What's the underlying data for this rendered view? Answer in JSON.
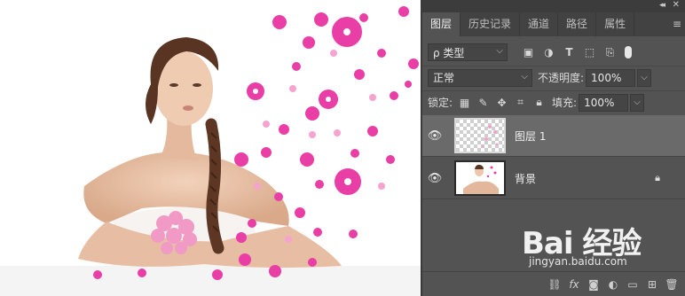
{
  "panel": {
    "tabs": [
      {
        "label": "图层",
        "active": true
      },
      {
        "label": "历史记录"
      },
      {
        "label": "通道"
      },
      {
        "label": "路径"
      },
      {
        "label": "属性"
      }
    ],
    "filter": {
      "label": "ρ 类型"
    },
    "blend_mode": "正常",
    "opacity_label": "不透明度:",
    "opacity_value": "100%",
    "lock_label": "锁定:",
    "fill_label": "填充:",
    "fill_value": "100%",
    "layers": [
      {
        "name": "图层 1",
        "selected": true,
        "visible": true
      },
      {
        "name": "背景",
        "selected": false,
        "visible": true,
        "locked": true
      }
    ]
  },
  "watermark": {
    "brand": "Bai  经验",
    "url": "jingyan.baidu.com"
  },
  "colors": {
    "panel_bg": "#535353",
    "tab_bar": "#424242",
    "selected_layer": "#6a6a6a",
    "petal_pink": "#e83ea5"
  },
  "icons": [
    "collapse-icon",
    "close-icon",
    "panel-menu-icon",
    "image-filter-icon",
    "adjustment-filter-icon",
    "type-filter-icon",
    "shape-filter-icon",
    "smart-object-filter-icon",
    "lock-pixels-icon",
    "lock-image-icon",
    "lock-position-icon",
    "lock-artboard-icon",
    "lock-all-icon",
    "eye-icon",
    "lock-icon",
    "link-icon",
    "fx-icon",
    "mask-icon",
    "adjustment-icon",
    "folder-icon",
    "new-layer-icon",
    "trash-icon"
  ]
}
